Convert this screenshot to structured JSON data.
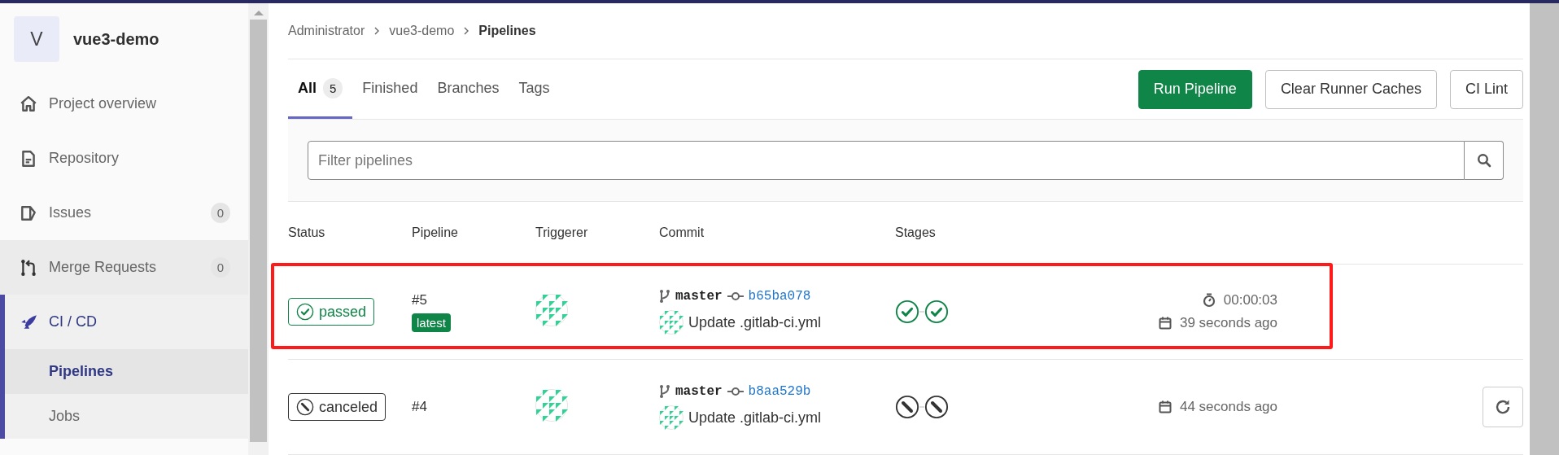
{
  "sidebar": {
    "project": {
      "avatar_letter": "V",
      "name": "vue3-demo"
    },
    "items": [
      {
        "label": "Project overview",
        "hovered": false,
        "selected": false
      },
      {
        "label": "Repository",
        "hovered": false,
        "selected": false
      },
      {
        "label": "Issues",
        "count": "0",
        "hovered": false,
        "selected": false
      },
      {
        "label": "Merge Requests",
        "count": "0",
        "hovered": true,
        "selected": false
      },
      {
        "label": "CI / CD",
        "hovered": false,
        "selected": true,
        "children": [
          {
            "label": "Pipelines",
            "selected": true
          },
          {
            "label": "Jobs",
            "selected": false
          }
        ]
      }
    ]
  },
  "breadcrumb": [
    "Administrator",
    "vue3-demo",
    "Pipelines"
  ],
  "tabs": [
    {
      "label": "All",
      "count": "5",
      "selected": true
    },
    {
      "label": "Finished",
      "selected": false
    },
    {
      "label": "Branches",
      "selected": false
    },
    {
      "label": "Tags",
      "selected": false
    }
  ],
  "actions": [
    {
      "label": "Run Pipeline",
      "kind": "primary"
    },
    {
      "label": "Clear Runner Caches",
      "kind": "default"
    },
    {
      "label": "CI Lint",
      "kind": "default"
    }
  ],
  "filter": {
    "placeholder": "Filter pipelines"
  },
  "table": {
    "columns": [
      "Status",
      "Pipeline",
      "Triggerer",
      "Commit",
      "Stages"
    ],
    "rows": [
      {
        "status": {
          "label": "passed",
          "kind": "passed"
        },
        "pipeline": "#5",
        "badge": "latest",
        "branch": "master",
        "sha": "b65ba078",
        "message": "Update .gitlab-ci.yml",
        "stages": [
          {
            "kind": "passed"
          },
          {
            "kind": "passed"
          }
        ],
        "duration": "00:00:03",
        "finished": "39 seconds ago",
        "retry": false,
        "highlighted": true
      },
      {
        "status": {
          "label": "canceled",
          "kind": "canceled"
        },
        "pipeline": "#4",
        "branch": "master",
        "sha": "b8aa529b",
        "message": "Update .gitlab-ci.yml",
        "stages": [
          {
            "kind": "canceled"
          },
          {
            "kind": "canceled"
          }
        ],
        "finished": "44 seconds ago",
        "retry": true,
        "highlighted": false
      }
    ]
  }
}
